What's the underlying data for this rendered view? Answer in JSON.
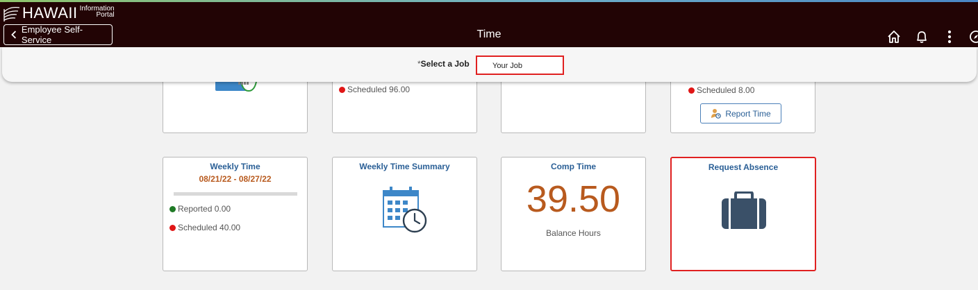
{
  "header": {
    "logo_word": "HAWAII",
    "logo_sub_line1": "Information",
    "logo_sub_line2": "Portal",
    "back_label": "Employee Self-Service",
    "title": "Time",
    "icons": [
      "home-icon",
      "bell-icon",
      "more-vertical-icon",
      "compass-icon"
    ]
  },
  "job_select": {
    "required_mark": "*",
    "label": "Select a Job",
    "value": "Your Job"
  },
  "tiles_row1": {
    "tile2_stat": "Scheduled 96.00",
    "tile4_stat": "Scheduled 8.00",
    "tile4_button": "Report Time"
  },
  "tiles_row2": {
    "weekly_time": {
      "title": "Weekly Time",
      "dates": "08/21/22 - 08/27/22",
      "reported": "Reported 0.00",
      "scheduled": "Scheduled 40.00"
    },
    "weekly_summary": {
      "title": "Weekly Time Summary"
    },
    "comp_time": {
      "title": "Comp Time",
      "value": "39.50",
      "caption": "Balance Hours"
    },
    "request_absence": {
      "title": "Request Absence"
    }
  },
  "colors": {
    "header_bg": "#220405",
    "tile_title": "#2a5f96",
    "date_orange": "#b85a1e",
    "highlight_red": "#e02020"
  }
}
